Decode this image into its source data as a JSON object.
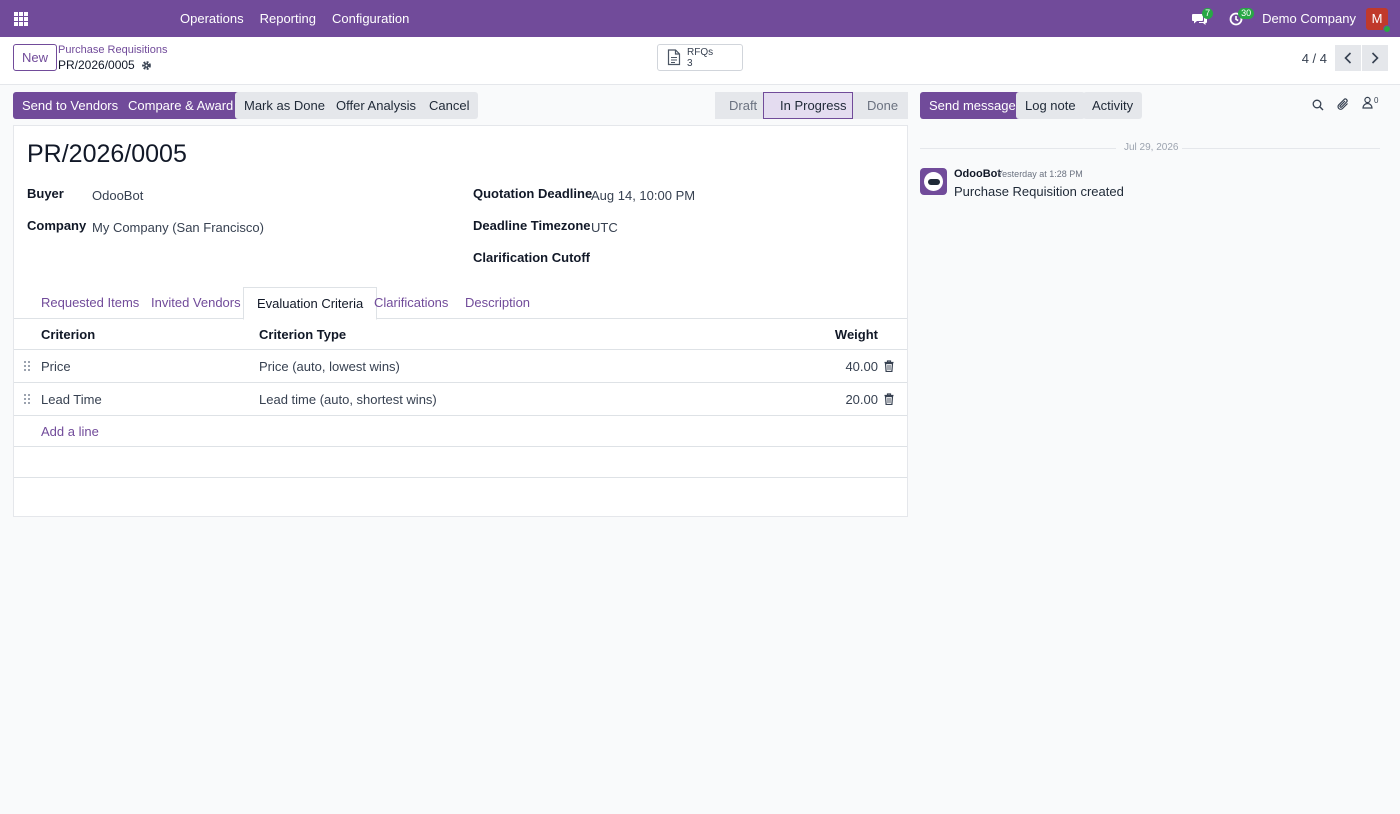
{
  "navbar": {
    "menu": [
      "Operations",
      "Reporting",
      "Configuration"
    ],
    "messages_count": "7",
    "activities_count": "30",
    "company": "Demo Company",
    "avatar_initial": "M"
  },
  "control": {
    "new_label": "New",
    "breadcrumb_parent": "Purchase Requisitions",
    "breadcrumb_current": "PR/2026/0005",
    "smart_button": {
      "label": "RFQs",
      "count": "3"
    },
    "pager": "4 / 4"
  },
  "actions": {
    "send_to_vendors": "Send to Vendors",
    "compare_award": "Compare & Award",
    "mark_done": "Mark as Done",
    "offer_analysis": "Offer Analysis",
    "cancel": "Cancel"
  },
  "status": {
    "stages": [
      "Draft",
      "In Progress",
      "Done"
    ],
    "current": "In Progress"
  },
  "form": {
    "title": "PR/2026/0005",
    "buyer_label": "Buyer",
    "buyer": "OdooBot",
    "company_label": "Company",
    "company": "My Company (San Francisco)",
    "deadline_label": "Quotation Deadline",
    "deadline": "Aug 14, 10:00 PM",
    "timezone_label": "Deadline Timezone",
    "timezone": "UTC",
    "cutoff_label": "Clarification Cutoff",
    "cutoff": ""
  },
  "tabs": [
    "Requested Items",
    "Invited Vendors",
    "Evaluation Criteria",
    "Clarifications",
    "Description"
  ],
  "active_tab": "Evaluation Criteria",
  "criteria_table": {
    "columns": [
      "Criterion",
      "Criterion Type",
      "Weight"
    ],
    "rows": [
      {
        "criterion": "Price",
        "type": "Price (auto, lowest wins)",
        "weight": "40.00"
      },
      {
        "criterion": "Lead Time",
        "type": "Lead time (auto, shortest wins)",
        "weight": "20.00"
      }
    ],
    "add_line": "Add a line"
  },
  "chatter": {
    "send_message": "Send message",
    "log_note": "Log note",
    "activity": "Activity",
    "followers_count": "0",
    "date": "Jul 29, 2026",
    "messages": [
      {
        "author": "OdooBot",
        "time": "Yesterday at 1:28 PM",
        "body": "Purchase Requisition created"
      }
    ]
  },
  "colors": {
    "brand": "#714b9a",
    "success": "#28a745",
    "avatar": "#c0392b"
  }
}
